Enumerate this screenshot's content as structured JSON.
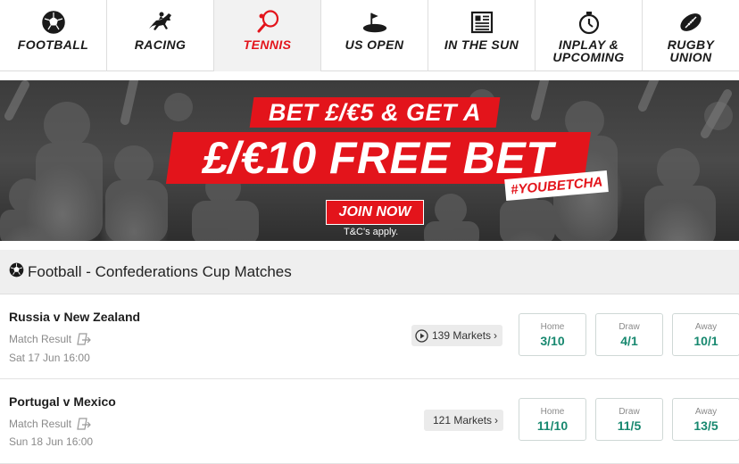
{
  "nav": {
    "tabs": [
      {
        "label": "FOOTBALL",
        "icon": "football-icon",
        "active": false
      },
      {
        "label": "RACING",
        "icon": "horse-racing-icon",
        "active": false
      },
      {
        "label": "TENNIS",
        "icon": "tennis-racket-icon",
        "active": true
      },
      {
        "label": "US OPEN",
        "icon": "golf-flag-icon",
        "active": false
      },
      {
        "label": "IN THE SUN",
        "icon": "newspaper-icon",
        "active": false
      },
      {
        "label": "INPLAY &\nUPCOMING",
        "icon": "stopwatch-icon",
        "active": false
      },
      {
        "label": "RUGBY\nUNION",
        "icon": "rugby-ball-icon",
        "active": false
      }
    ],
    "active_color": "#e3141b"
  },
  "banner": {
    "line1": "BET £/€5 & GET A",
    "line2": "£/€10 FREE BET",
    "hashtag": "#YOUBETCHA",
    "cta": "JOIN NOW",
    "terms": "T&C's apply.",
    "brand_color": "#e3141b"
  },
  "section": {
    "icon": "football-icon",
    "title": "Football - Confederations Cup Matches"
  },
  "matches": [
    {
      "name": "Russia v New Zealand",
      "market_type": "Match Result",
      "date": "Sat 17 Jun 16:00",
      "markets_label": "139 Markets",
      "has_stream": true,
      "odds": [
        {
          "label": "Home",
          "price": "3/10"
        },
        {
          "label": "Draw",
          "price": "4/1"
        },
        {
          "label": "Away",
          "price": "10/1"
        }
      ]
    },
    {
      "name": "Portugal v Mexico",
      "market_type": "Match Result",
      "date": "Sun 18 Jun 16:00",
      "markets_label": "121 Markets",
      "has_stream": false,
      "odds": [
        {
          "label": "Home",
          "price": "11/10"
        },
        {
          "label": "Draw",
          "price": "11/5"
        },
        {
          "label": "Away",
          "price": "13/5"
        }
      ]
    }
  ],
  "odds_color": "#17886f"
}
